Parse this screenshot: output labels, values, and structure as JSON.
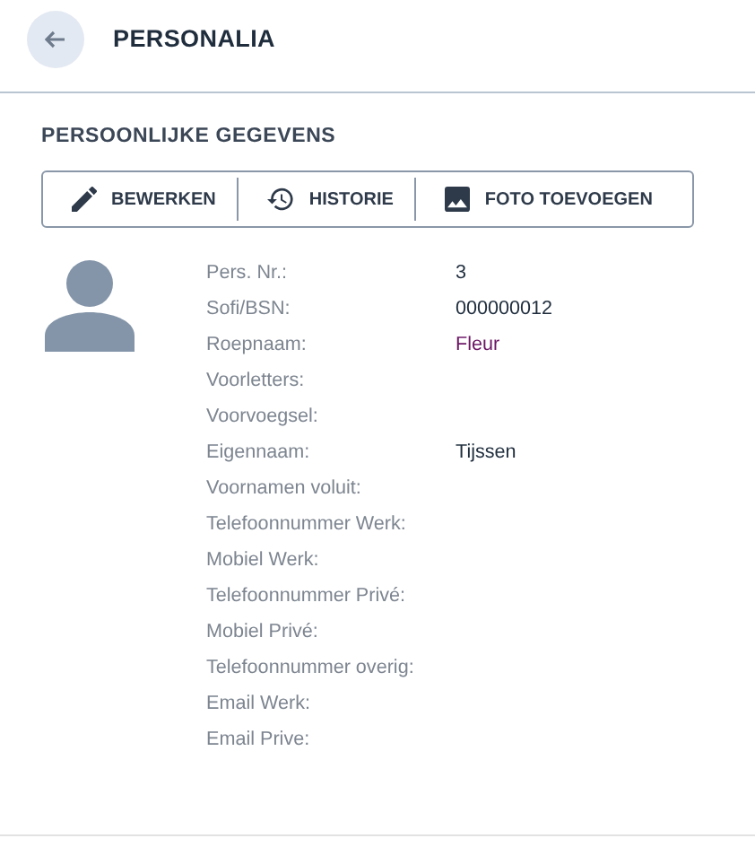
{
  "header": {
    "title": "PERSONALIA"
  },
  "section": {
    "title": "PERSOONLIJKE GEGEVENS",
    "actions": [
      {
        "label": "BEWERKEN",
        "kind": "edit"
      },
      {
        "label": "HISTORIE",
        "kind": "history"
      },
      {
        "label": "FOTO TOEVOEGEN",
        "kind": "photo"
      }
    ],
    "fields": [
      {
        "label": "Pers. Nr.:",
        "value": "3",
        "kind": "text"
      },
      {
        "label": "Sofi/BSN:",
        "value": "000000012",
        "kind": "text"
      },
      {
        "label": "Roepnaam:",
        "value": "Fleur",
        "kind": "link"
      },
      {
        "label": "Voorletters:",
        "kind": "text"
      },
      {
        "label": "Voorvoegsel:",
        "kind": "text"
      },
      {
        "label": "Eigennaam:",
        "value": "Tijssen",
        "kind": "text"
      },
      {
        "label": "Voornamen voluit:",
        "kind": "text"
      },
      {
        "label": "Telefoonnummer Werk:",
        "kind": "text"
      },
      {
        "label": "Mobiel Werk:",
        "kind": "text"
      },
      {
        "label": "Telefoonnummer Privé:",
        "kind": "text"
      },
      {
        "label": "Mobiel Privé:",
        "kind": "text"
      },
      {
        "label": "Telefoonnummer overig:",
        "kind": "text"
      },
      {
        "label": "Email Werk:",
        "kind": "text"
      },
      {
        "label": "Email Prive:",
        "kind": "text"
      }
    ]
  }
}
